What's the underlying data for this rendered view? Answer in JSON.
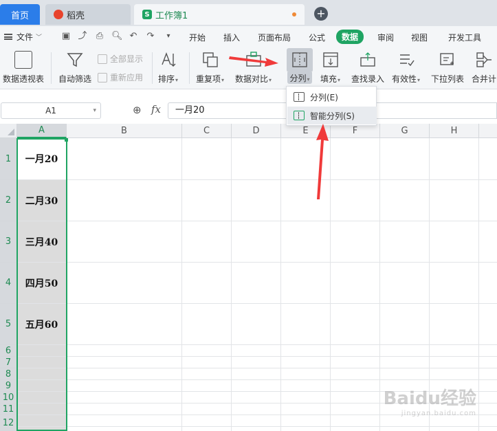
{
  "tabs": {
    "home": "首页",
    "doc1": "稻壳",
    "doc2": "工作簿1",
    "add": "+"
  },
  "menu": {
    "file": "文件",
    "tabs": [
      "开始",
      "插入",
      "页面布局",
      "公式",
      "数据",
      "审阅",
      "视图",
      "开发工具"
    ],
    "active_tab": "数据"
  },
  "ribbon": {
    "pivot": "数据透视表",
    "autofilter": "自动筛选",
    "show_all": "全部显示",
    "reapply": "重新应用",
    "sort": "排序",
    "duplicates": "重复项",
    "compare": "数据对比",
    "split": "分列",
    "fill": "填充",
    "lookup": "查找录入",
    "validity": "有效性",
    "dropdown_list": "下拉列表",
    "merge": "合并计"
  },
  "split_menu": {
    "item1": "分列(E)",
    "item2": "智能分列(S)"
  },
  "formula_bar": {
    "name_box": "A1",
    "fx": "fx",
    "value": "一月20"
  },
  "columns": [
    "A",
    "B",
    "C",
    "D",
    "E",
    "F",
    "G",
    "H"
  ],
  "rows": [
    "1",
    "2",
    "3",
    "4",
    "5",
    "6",
    "7",
    "8",
    "9",
    "10",
    "11",
    "12"
  ],
  "cells": {
    "A1": "一月20",
    "A2": "二月30",
    "A3": "三月40",
    "A4": "四月50",
    "A5": "五月60"
  },
  "colors": {
    "accent": "#1fa463",
    "tab_blue": "#2b7de9",
    "arrow_red": "#f03a3a"
  },
  "watermark": {
    "brand": "Baidu经验",
    "sub": "jingyan.baidu.com"
  }
}
